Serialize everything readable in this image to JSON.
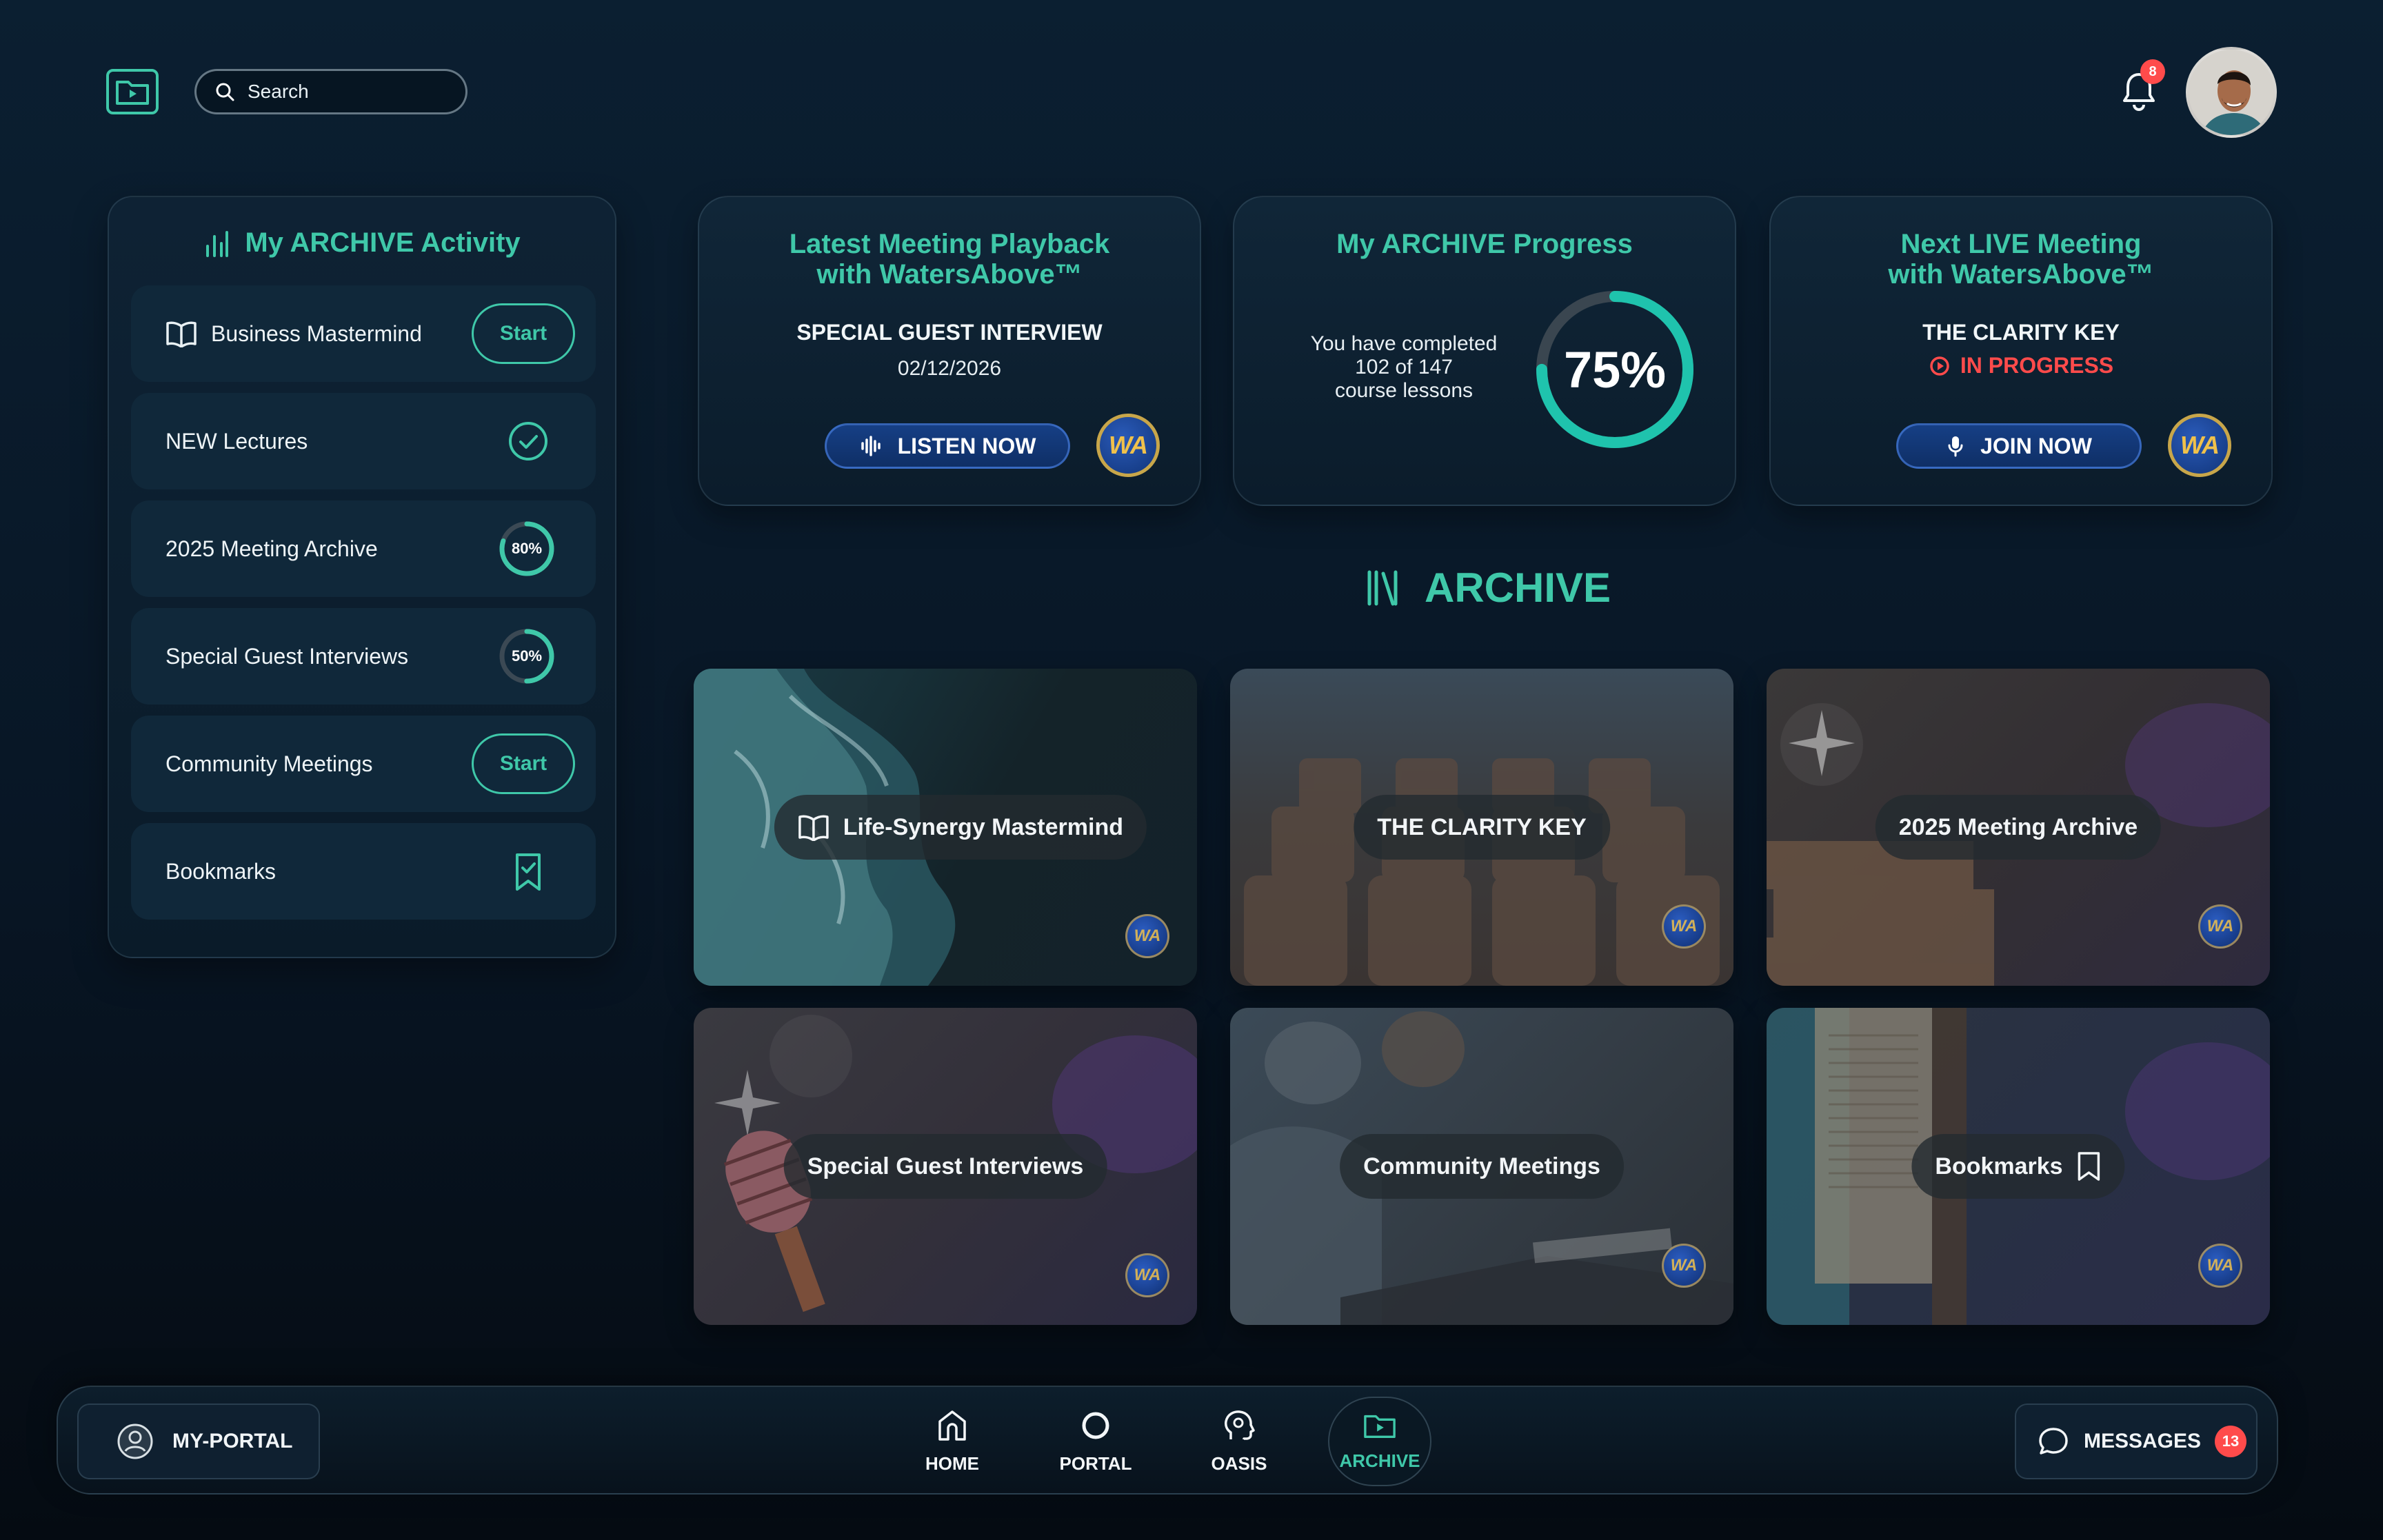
{
  "search": {
    "label": "Search"
  },
  "notifications": {
    "count": "8"
  },
  "activity": {
    "title": "My ARCHIVE Activity",
    "items": [
      {
        "label": "Business Mastermind",
        "action": "Start"
      },
      {
        "label": "NEW Lectures",
        "status": "completed"
      },
      {
        "label": "2025 Meeting Archive",
        "progress": "80%",
        "progress_value": 0.8
      },
      {
        "label": "Special Guest Interviews",
        "progress": "50%",
        "progress_value": 0.5
      },
      {
        "label": "Community Meetings",
        "action": "Start"
      },
      {
        "label": "Bookmarks",
        "icon": "bookmark-icon"
      }
    ]
  },
  "cards": {
    "playback": {
      "title_line1": "Latest Meeting Playback",
      "title_line2": "with WatersAbove™",
      "subtitle": "SPECIAL GUEST INTERVIEW",
      "date": "02/12/2026",
      "button": "LISTEN NOW",
      "badge": "WA"
    },
    "progress": {
      "title": "My ARCHIVE Progress",
      "line1": "You have completed",
      "line2": "102 of 147",
      "line3": "course lessons",
      "percent": "75%",
      "percent_value": 0.75
    },
    "live": {
      "title_line1": "Next LIVE Meeting",
      "title_line2": "with WatersAbove™",
      "subtitle": "THE CLARITY KEY",
      "status": "IN PROGRESS",
      "button": "JOIN NOW",
      "badge": "WA"
    }
  },
  "archive": {
    "heading": "ARCHIVE",
    "tiles": [
      {
        "label": "Life-Synergy Mastermind",
        "badge": "WA"
      },
      {
        "label": "THE CLARITY KEY",
        "badge": "WA"
      },
      {
        "label": "2025 Meeting Archive",
        "badge": "WA"
      },
      {
        "label": "Special Guest Interviews",
        "badge": "WA"
      },
      {
        "label": "Community Meetings",
        "badge": "WA"
      },
      {
        "label": "Bookmarks",
        "badge": "WA"
      }
    ]
  },
  "bottom_nav": {
    "portal": "MY-PORTAL",
    "items": [
      {
        "label": "HOME"
      },
      {
        "label": "PORTAL"
      },
      {
        "label": "OASIS"
      },
      {
        "label": "ARCHIVE"
      }
    ],
    "messages": "MESSAGES",
    "messages_count": "13"
  },
  "colors": {
    "accent": "#3fc8a9",
    "alert": "#ff4b4b",
    "button": "#163f85"
  }
}
